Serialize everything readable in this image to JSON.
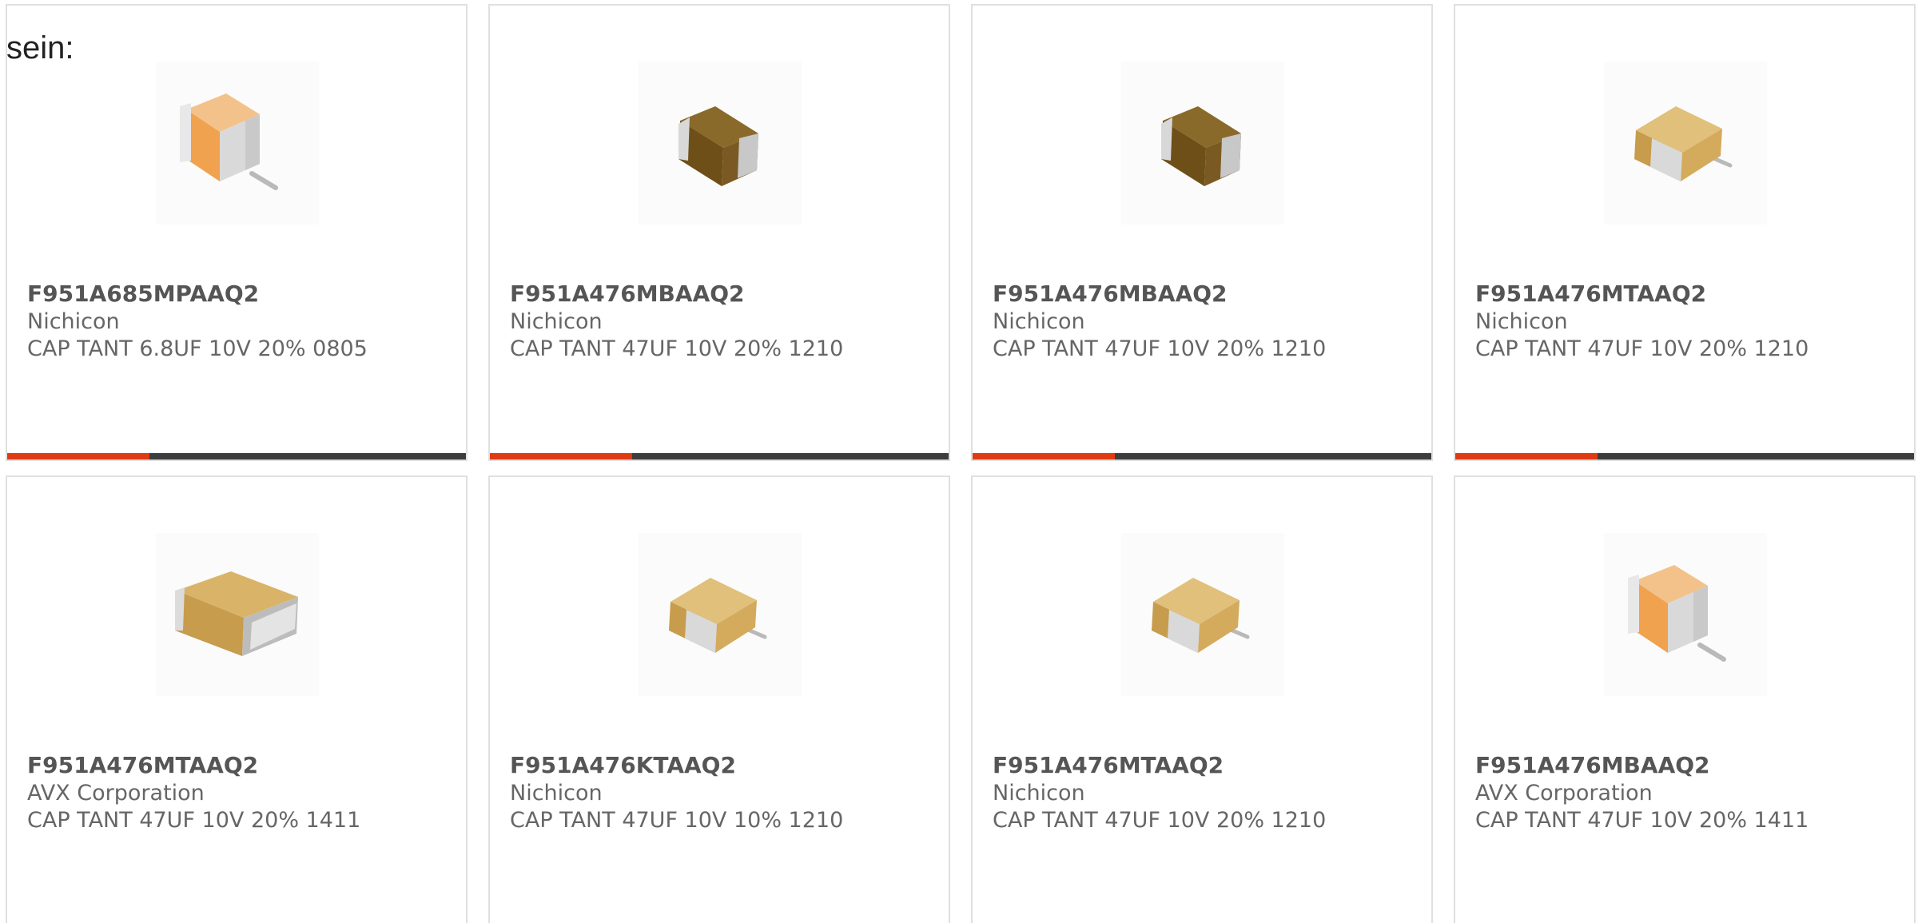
{
  "intro_text": "sein:",
  "colors": {
    "accent": "#e03a12",
    "bar_track": "#3d3d3d",
    "card_border": "#e0e0e0"
  },
  "products": [
    {
      "part_number": "F951A685MPAAQ2",
      "manufacturer": "Nichicon",
      "description": "CAP TANT 6.8UF 10V 20% 0805",
      "image": "capacitor-orange-tall",
      "progress": 0.31
    },
    {
      "part_number": "F951A476MBAAQ2",
      "manufacturer": "Nichicon",
      "description": "CAP TANT 47UF 10V 20% 1210",
      "image": "capacitor-brown",
      "progress": 0.31
    },
    {
      "part_number": "F951A476MBAAQ2",
      "manufacturer": "Nichicon",
      "description": "CAP TANT 47UF 10V 20% 1210",
      "image": "capacitor-brown",
      "progress": 0.31
    },
    {
      "part_number": "F951A476MTAAQ2",
      "manufacturer": "Nichicon",
      "description": "CAP TANT 47UF 10V 20% 1210",
      "image": "capacitor-tan",
      "progress": 0.31
    },
    {
      "part_number": "F951A476MTAAQ2",
      "manufacturer": "AVX Corporation",
      "description": "CAP TANT 47UF 10V 20% 1411",
      "image": "capacitor-tan-wide"
    },
    {
      "part_number": "F951A476KTAAQ2",
      "manufacturer": "Nichicon",
      "description": "CAP TANT 47UF 10V 10% 1210",
      "image": "capacitor-tan"
    },
    {
      "part_number": "F951A476MTAAQ2",
      "manufacturer": "Nichicon",
      "description": "CAP TANT 47UF 10V 20% 1210",
      "image": "capacitor-tan"
    },
    {
      "part_number": "F951A476MBAAQ2",
      "manufacturer": "AVX Corporation",
      "description": "CAP TANT 47UF 10V 20% 1411",
      "image": "capacitor-orange-tall"
    }
  ]
}
